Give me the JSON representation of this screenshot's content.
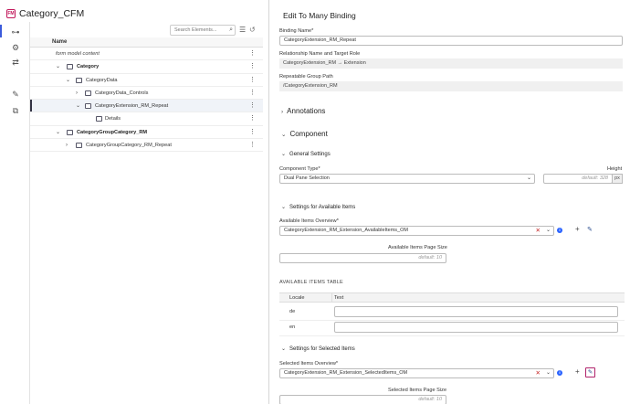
{
  "app": {
    "title": "Category_CFM",
    "icon": "document-icon"
  },
  "rail": {
    "icons": [
      "tree-icon",
      "gear-icon",
      "arrows-icon",
      "brush-icon",
      "export-icon"
    ]
  },
  "search": {
    "placeholder": "Search Elements..."
  },
  "tree": {
    "column_header": "Name",
    "rows": [
      {
        "label": "form model content"
      },
      {
        "label": "Category"
      },
      {
        "label": "CategoryData"
      },
      {
        "label": "CategoryData_Controls"
      },
      {
        "label": "CategoryExtension_RM_Repeat"
      },
      {
        "label": "Details"
      },
      {
        "label": "CategoryGroupCategory_RM"
      },
      {
        "label": "CategoryGroupCategory_RM_Repeat"
      }
    ]
  },
  "panel": {
    "title": "Edit To Many Binding",
    "binding_name_label": "Binding Name*",
    "binding_name_value": "CategoryExtension_RM_Repeat",
    "relationship_label": "Relationship Name and Target Role",
    "relationship_value": "CategoryExtension_RM → Extension",
    "group_path_label": "Repeatable Group Path",
    "group_path_value": "/CategoryExtension_RM",
    "annotations": "Annotations",
    "component": "Component",
    "general_settings": "General Settings",
    "component_type_label": "Component Type*",
    "component_type_value": "Dual Pane Selection",
    "height_label": "Height",
    "height_placeholder": "default: 328",
    "height_unit": "px",
    "available_settings": "Settings for Available Items",
    "available_overview_label": "Available Items Overview*",
    "available_overview_value": "CategoryExtension_RM_Extension_AvailableItems_OM",
    "available_page_size_label": "Available Items Page Size",
    "available_page_size_placeholder": "default: 10",
    "available_table_caption": "AVAILABLE ITEMS TABLE",
    "table_col_locale": "Locale",
    "table_col_text": "Text",
    "locales": [
      "de",
      "en"
    ],
    "selected_settings": "Settings for Selected Items",
    "selected_overview_label": "Selected Items Overview*",
    "selected_overview_value": "CategoryExtension_RM_Extension_SelectedItems_OM",
    "selected_page_size_label": "Selected Items Page Size",
    "selected_page_size_placeholder": "default: 10"
  }
}
